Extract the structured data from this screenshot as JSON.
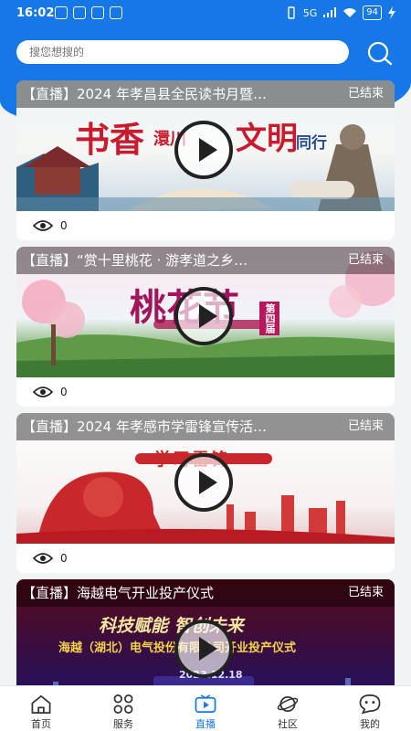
{
  "status_bar": {
    "time": "16:02",
    "signal_label": "5G",
    "battery": "94"
  },
  "search": {
    "placeholder": "搜您想搜的"
  },
  "cards": [
    {
      "title": "【直播】2024 年孝昌县全民读书月暨…",
      "status": "已结束",
      "views": "0",
      "art_main": "书香",
      "art_mid": "澴川",
      "art_right": "文明",
      "art_sub": "同行"
    },
    {
      "title": "【直播】“赏十里桃花 · 游孝道之乡…",
      "status": "已结束",
      "views": "0",
      "art_main": "桃花节",
      "art_sub": "第四届"
    },
    {
      "title": "【直播】2024 年孝感市学雷锋宣传活…",
      "status": "已结束",
      "views": "0",
      "art_main": "学习雷锋"
    },
    {
      "title": "【直播】海越电气开业投产仪式",
      "status": "已结束",
      "views": "",
      "art_main": "科技赋能  智创未来",
      "art_sub": "海越（湖北）电气投份有限公司开业投产仪式",
      "art_date": "2023.12.18"
    }
  ],
  "tabs": [
    {
      "label": "首页"
    },
    {
      "label": "服务"
    },
    {
      "label": "直播"
    },
    {
      "label": "社区"
    },
    {
      "label": "我的"
    }
  ],
  "colors": {
    "primary": "#1677e6",
    "background": "#f2f3f5"
  }
}
